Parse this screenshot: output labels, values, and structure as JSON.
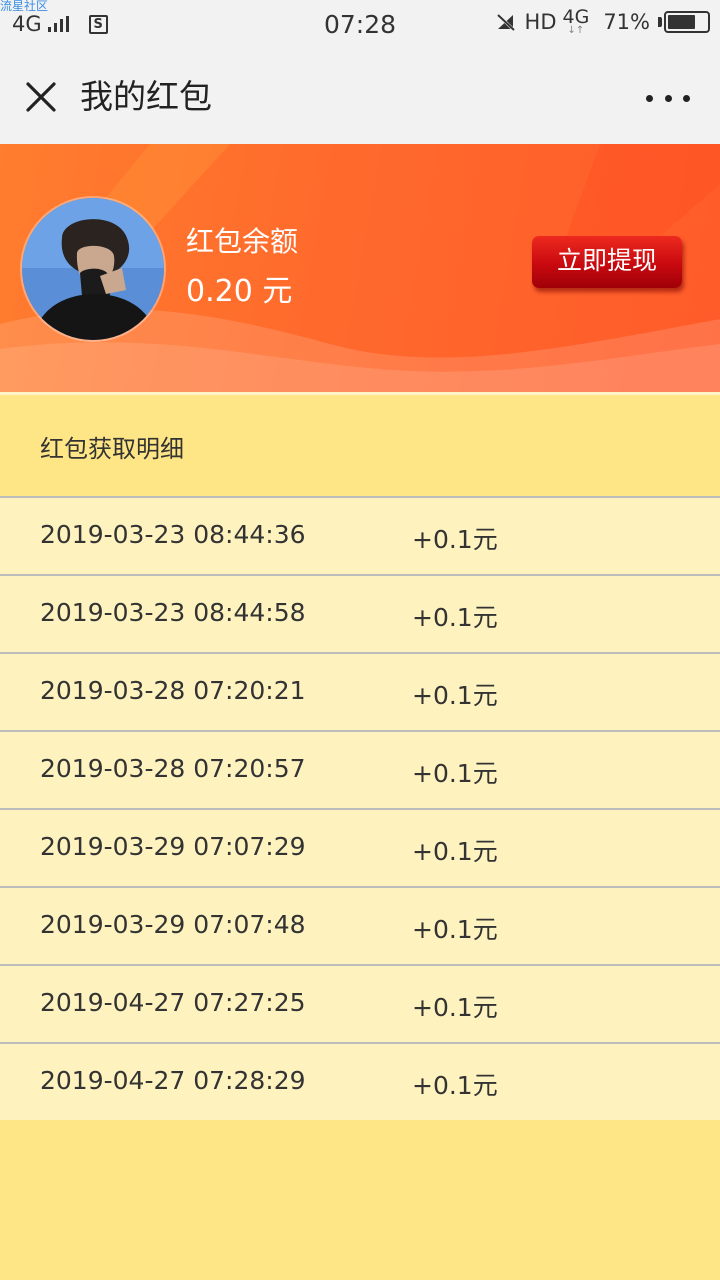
{
  "status_bar": {
    "watermark": "流星社区",
    "network": "4G",
    "time": "07:28",
    "hd": "HD",
    "network2": "4G",
    "battery": "71%",
    "sim_icon": "S"
  },
  "nav": {
    "title": "我的红包",
    "close_icon": "close-icon",
    "more_icon": "more-icon"
  },
  "banner": {
    "balance_label": "红包余额",
    "balance_value": "0.20 元",
    "withdraw_label": "立即提现",
    "colors": {
      "accent": "#ff6a2c",
      "button": "#c8090f"
    }
  },
  "section": {
    "title": "红包获取明细"
  },
  "records": [
    {
      "date": "2019-03-23 08:44:36",
      "amount": "+0.1元"
    },
    {
      "date": "2019-03-23 08:44:58",
      "amount": "+0.1元"
    },
    {
      "date": "2019-03-28 07:20:21",
      "amount": "+0.1元"
    },
    {
      "date": "2019-03-28 07:20:57",
      "amount": "+0.1元"
    },
    {
      "date": "2019-03-29 07:07:29",
      "amount": "+0.1元"
    },
    {
      "date": "2019-03-29 07:07:48",
      "amount": "+0.1元"
    },
    {
      "date": "2019-04-27 07:27:25",
      "amount": "+0.1元"
    },
    {
      "date": "2019-04-27 07:28:29",
      "amount": "+0.1元"
    }
  ]
}
